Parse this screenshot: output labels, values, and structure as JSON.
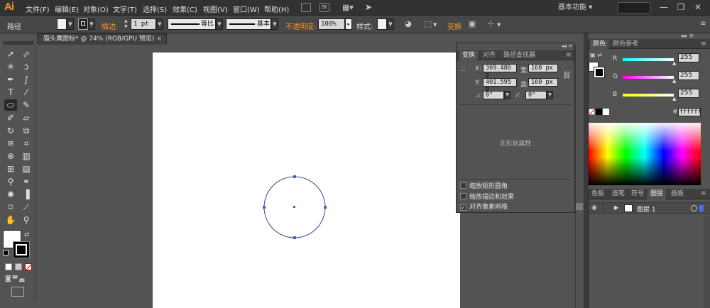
{
  "app": {
    "logo": "Ai"
  },
  "menu": [
    "文件(F)",
    "编辑(E)",
    "对象(O)",
    "文字(T)",
    "选择(S)",
    "效果(C)",
    "视图(V)",
    "窗口(W)",
    "帮助(H)"
  ],
  "menubar_icons": {
    "st": "St"
  },
  "workspace": "基本功能",
  "window_controls": {
    "minimize": "—",
    "restore": "❐",
    "close": "✕"
  },
  "control_bar": {
    "object_type": "路径",
    "stroke_label": "描边:",
    "stroke_weight": "1 pt",
    "profile": "等比",
    "brush": "基本",
    "opacity_label": "不透明度:",
    "opacity": "100%",
    "style_label": "样式:",
    "transform_label": "变换"
  },
  "document_tab": {
    "title": "猫头鹰图标* @ 74% (RGB/GPU 预览)",
    "close": "×"
  },
  "transform_panel": {
    "tabs": [
      "变换",
      "对齐",
      "路径查找器"
    ],
    "x_label": "X:",
    "x": "369.486 p",
    "y_label": "Y:",
    "y": "401.595 p",
    "w_label": "宽:",
    "w": "160 px",
    "h_label": "高:",
    "h": "160 px",
    "rotate": "0°",
    "shear": "0°",
    "no_shape": "无形状属性",
    "options": [
      {
        "label": "缩放矩形圆角",
        "checked": false
      },
      {
        "label": "缩放描边和效果",
        "checked": false
      },
      {
        "label": "对齐像素网格",
        "checked": true
      }
    ]
  },
  "color_panel": {
    "tabs": [
      "颜色",
      "颜色参考"
    ],
    "r_label": "R",
    "r": "255",
    "g_label": "G",
    "g": "255",
    "b_label": "B",
    "b": "255",
    "hex_label": "#",
    "hex": "ffffff"
  },
  "layers_panel": {
    "tabs": [
      "色板",
      "画笔",
      "符号",
      "图层",
      "画板"
    ],
    "layers": [
      {
        "name": "图层 1",
        "color": "#4f6bff"
      }
    ]
  },
  "colors": {
    "accent": "#f7941d",
    "path_blue": "#4a5fc1"
  }
}
